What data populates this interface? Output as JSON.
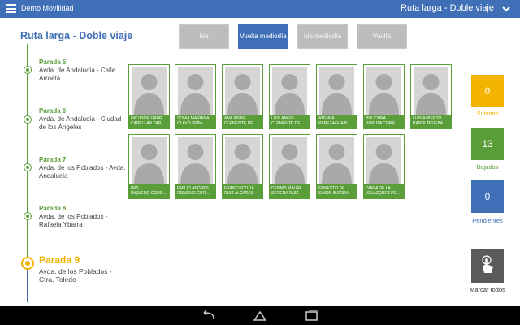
{
  "appbar": {
    "app_title": "Demo Movilidad",
    "route_title": "Ruta larga - Doble viaje",
    "menu_icon": "hamburger-menu-icon",
    "dropdown_icon": "chevron-down-icon"
  },
  "page_title": "Ruta larga - Doble viaje",
  "tabs": [
    {
      "label": "Ida",
      "active": false
    },
    {
      "label": "Vuelta mediodía",
      "active": true
    },
    {
      "label": "Ida mediodía",
      "active": false
    },
    {
      "label": "Vuelta",
      "active": false
    }
  ],
  "stops": [
    {
      "name": "Parada 5",
      "address": "Avda. de Andalucía - Calle Arroeta",
      "current": false
    },
    {
      "name": "Parada 6",
      "address": "Avda. de Andalucía - Ciudad de los Ángeles",
      "current": false
    },
    {
      "name": "Parada 7",
      "address": "Avda. de los Poblados - Avda. Andalucía",
      "current": false
    },
    {
      "name": "Parada 8",
      "address": "Avda. de los Poblados - Rafaela Ybarra",
      "current": false
    },
    {
      "name": "Parada 9",
      "address": "Avda. de los Poblados - Ctra. Toledo",
      "current": true
    }
  ],
  "passengers": [
    {
      "line1": "NICUSOR GABR...",
      "line2": "CAPELLAN ZAR..."
    },
    {
      "line1": "SONIA MARIANA",
      "line2": "CLAVO SEBA"
    },
    {
      "line1": "ANA IRENE",
      "line2": "CLEMENTE DE..."
    },
    {
      "line1": "LUIS ANGEL",
      "line2": "CLEMENTE DE..."
    },
    {
      "line1": "ATENEA",
      "line2": "PEREZAGUA B..."
    },
    {
      "line1": "BOUCHRA",
      "line2": "POPUTA CORR..."
    },
    {
      "line1": "LUIS ALBERTO",
      "line2": "RANDI TRUEBA"
    },
    {
      "line1": "IRIS",
      "line2": "RIQUEÑO CÓRD..."
    },
    {
      "line1": "EMILIO ANDRÉS",
      "line2": "RISUEÑO CÓR..."
    },
    {
      "line1": "FRANCISCO JA...",
      "line2": "RUIZ ALCARAZ"
    },
    {
      "line1": "DENNIS MAURI...",
      "line2": "SERENA RUIZ"
    },
    {
      "line1": "ERNESTO DE",
      "line2": "SIMON IBORRA"
    },
    {
      "line1": "DIANA DE LA",
      "line2": "VELÁZQUEZ PE..."
    }
  ],
  "counters": [
    {
      "value": "0",
      "label": "Subidos",
      "color": "#f2b400"
    },
    {
      "value": "13",
      "label": "Bajados",
      "color": "#5a9e3a"
    },
    {
      "value": "0",
      "label": "Pendientes",
      "color": "#3f6fb6"
    }
  ],
  "mark_all": {
    "label": "Marcar todos",
    "icon": "touch-hand-icon"
  },
  "navbar": {
    "back_icon": "back-icon",
    "home_icon": "home-icon",
    "recents_icon": "recents-icon"
  }
}
